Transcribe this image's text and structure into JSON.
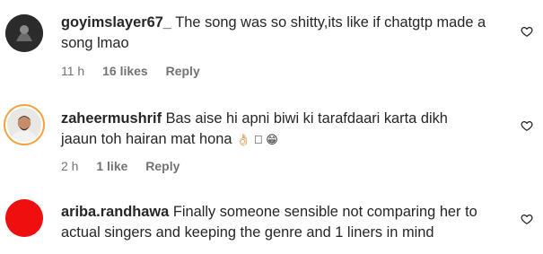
{
  "comments": [
    {
      "username": "goyimslayer67_",
      "text": "The song was so shitty,its like if chatgtp made a song lmao",
      "time": "11 h",
      "likes": "16 likes",
      "reply": "Reply",
      "avatar": "dark-icon-avatar"
    },
    {
      "username": "zaheermushrif",
      "text": "Bas aise hi apni biwi ki tarafdaari karta dikh jaaun toh hairan mat hona",
      "emoji": "👌🏻 ⃞ 😁",
      "time": "2 h",
      "likes": "1 like",
      "reply": "Reply",
      "avatar": "photo-avatar-with-story-ring"
    },
    {
      "username": "ariba.randhawa",
      "text": "Finally someone sensible not comparing her to actual singers and keeping the genre and 1 liners in mind",
      "avatar": "red-circle-avatar"
    }
  ],
  "colors": {
    "text": "#262626",
    "meta": "#737373",
    "story_ring": "#f6a23a",
    "red_avatar": "#ef0f0f"
  }
}
